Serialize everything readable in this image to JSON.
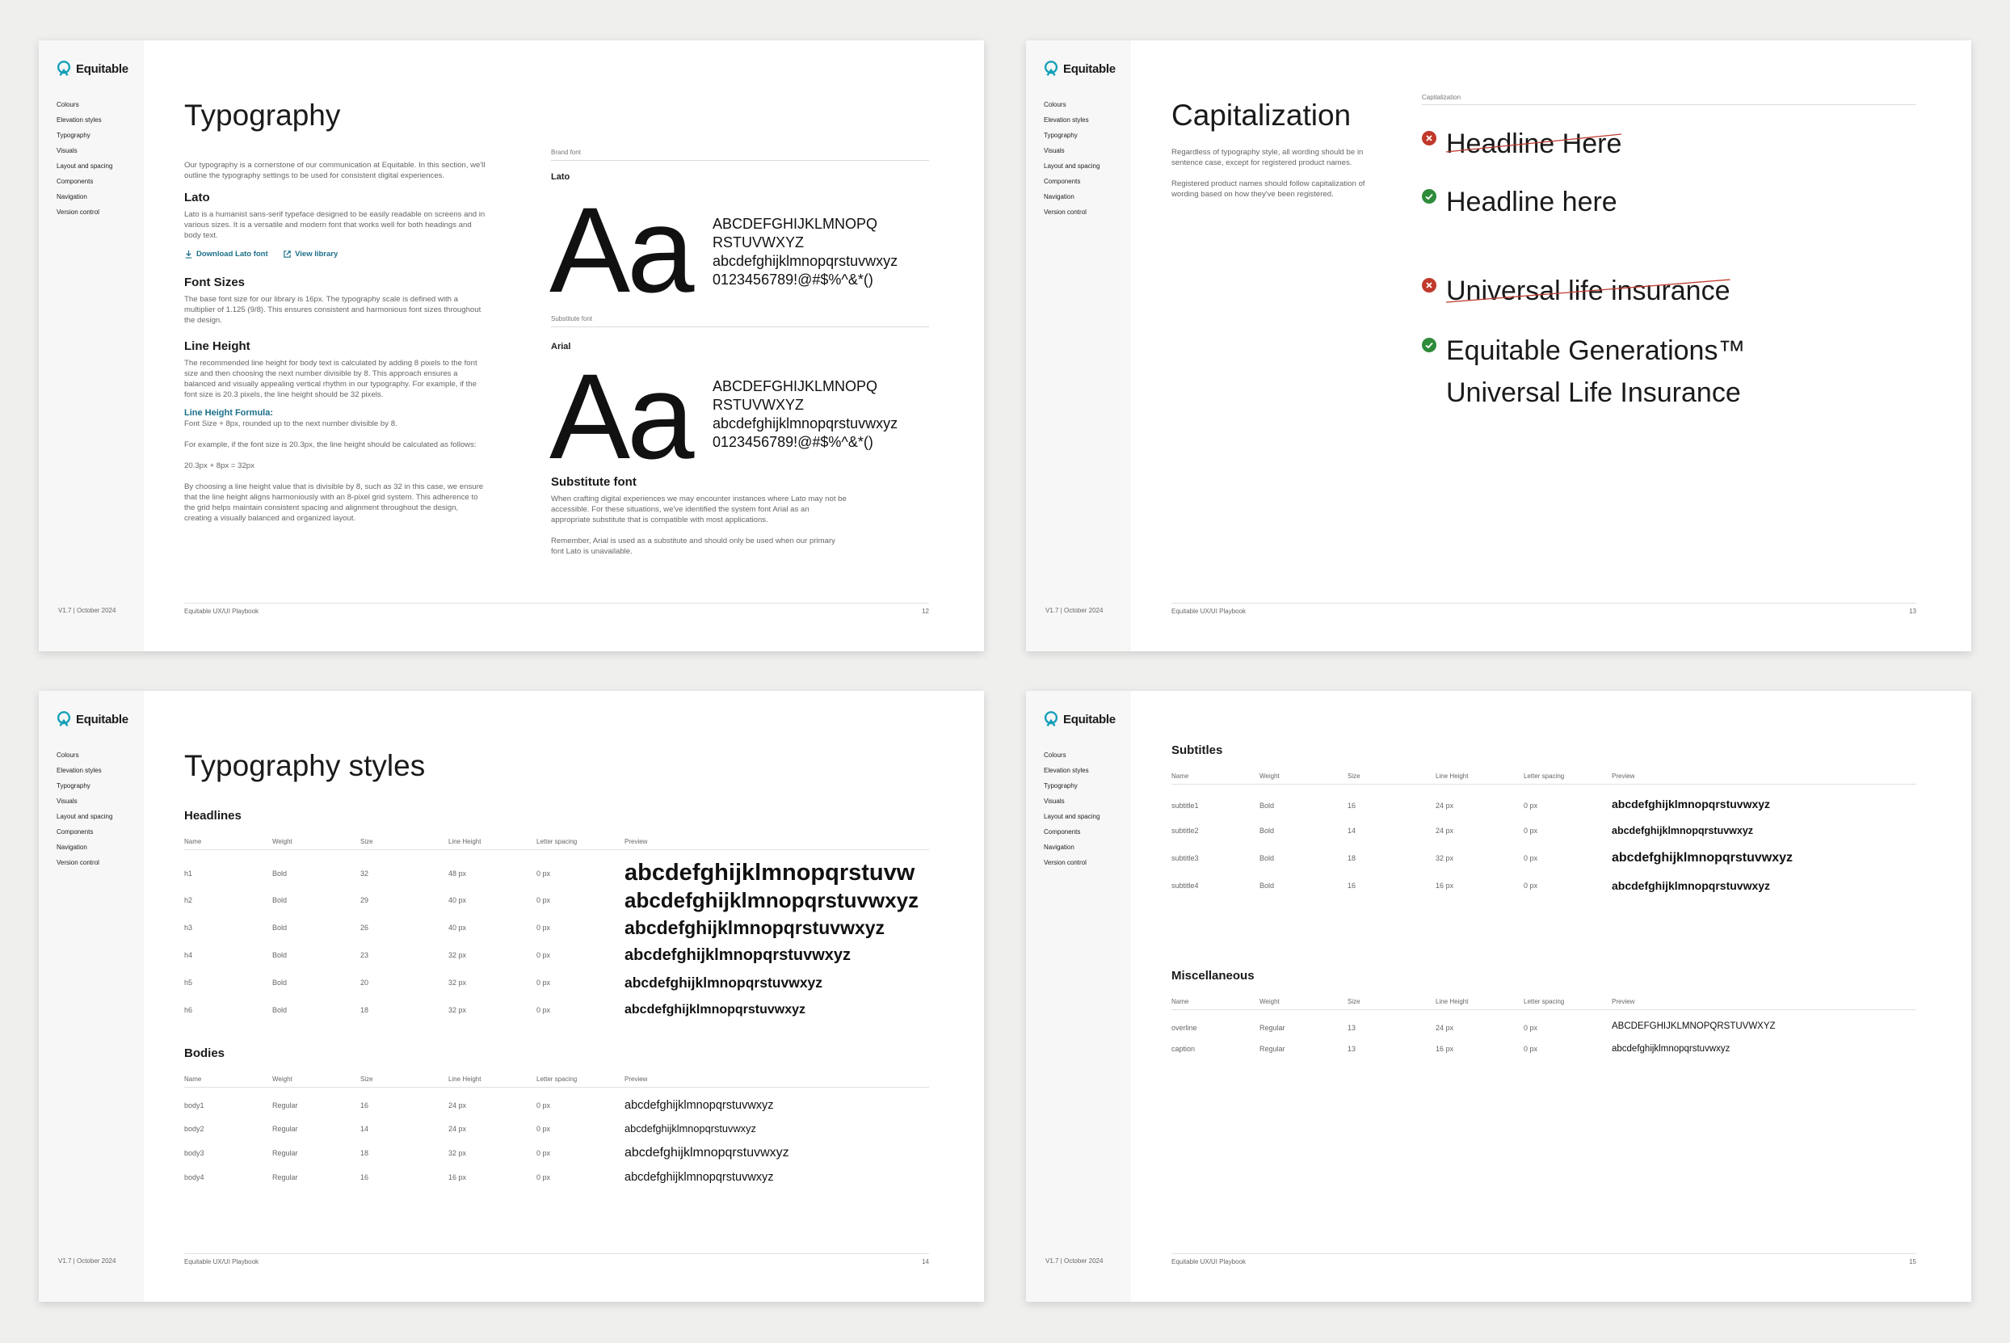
{
  "common": {
    "brand": "Equitable",
    "nav": [
      "Colours",
      "Elevation styles",
      "Typography",
      "Visuals",
      "Layout and spacing",
      "Components",
      "Navigation",
      "Version control"
    ],
    "version": "V1.7  |  October 2024",
    "footer_title": "Equitable UX/UI Playbook"
  },
  "colors": {
    "accent": "#1b6f8a",
    "error": "#c0392b",
    "success": "#2e8b3a",
    "sidebar": "#f7f7f7"
  },
  "page12": {
    "number": "12",
    "title": "Typography",
    "intro": "Our typography is a cornerstone of our communication at Equitable. In this section, we'll outline the typography settings to be used for consistent digital experiences.",
    "lato_heading": "Lato",
    "lato_text": "Lato is a humanist sans-serif typeface designed to be easily readable on screens and in various sizes. It is a versatile and modern font that works well for both headings and body text.",
    "download_link": "Download Lato font",
    "library_link": "View library",
    "font_sizes_heading": "Font Sizes",
    "font_sizes_text": "The base font size for our library is 16px. The typography scale is defined with a multiplier of 1.125 (9/8). This ensures consistent and harmonious font sizes throughout the design.",
    "line_height_heading": "Line Height",
    "line_height_text": "The recommended line height for body text is calculated by adding 8 pixels to the font size and then choosing the next number divisible by 8. This approach ensures a balanced and visually appealing vertical rhythm in our typography. For example, if the font size is 20.3 pixels, the line height should be 32 pixels.",
    "formula_heading": "Line Height Formula:",
    "formula_text": "Font Size + 8px, rounded up to the next number divisible by 8.",
    "example_text": "For example, if the font size is 20.3px, the line height should be calculated as follows:",
    "example_calc": "20.3px + 8px = 32px",
    "closing_text": "By choosing a line height value that is divisible by 8, such as 32 in this case, we ensure that the line height aligns harmoniously with an 8-pixel grid system. This adherence to the grid helps maintain consistent spacing and alignment throughout the design, creating a visually balanced and organized layout.",
    "brand_font_label": "Brand font",
    "brand_font_name": "Lato",
    "substitute_font_label": "Substitute font",
    "substitute_font_name": "Arial",
    "aa": "Aa",
    "chars_line1": "ABCDEFGHIJKLMNOPQ",
    "chars_line2": "RSTUVWXYZ",
    "chars_line3": "abcdefghijklmnopqrstuvwxyz",
    "chars_line4": "0123456789!@#$%^&*()",
    "substitute_heading": "Substitute font",
    "substitute_text": "When crafting digital experiences we may encounter instances where Lato may not be accessible. For these situations, we've identified the system font Arial as an appropriate substitute that is compatible with most applications.",
    "substitute_note": "Remember, Arial is used as a substitute and should only be used when our primary font Lato is unavailable."
  },
  "page13": {
    "number": "13",
    "title": "Capitalization",
    "text1": "Regardless of typography style, all wording should be in sentence case, except for registered product names.",
    "text2": "Registered product names should follow capitalization of wording based on how they've been registered.",
    "section_label": "Capitalization",
    "bad1": "Headline Here",
    "good1": "Headline here",
    "bad2": "Universal life insurance",
    "good2_line1": "Equitable Generations™",
    "good2_line2": "Universal Life Insurance"
  },
  "columns": [
    "Name",
    "Weight",
    "Size",
    "Line Height",
    "Letter spacing",
    "Preview"
  ],
  "page14": {
    "number": "14",
    "title": "Typography styles",
    "headlines_heading": "Headlines",
    "headlines": [
      {
        "name": "h1",
        "weight": "Bold",
        "size": "32",
        "lh": "48 px",
        "ls": "0 px",
        "preview": "abcdefghijklmnopqrstuvw"
      },
      {
        "name": "h2",
        "weight": "Bold",
        "size": "29",
        "lh": "40 px",
        "ls": "0 px",
        "preview": "abcdefghijklmnopqrstuvwxyz"
      },
      {
        "name": "h3",
        "weight": "Bold",
        "size": "26",
        "lh": "40 px",
        "ls": "0 px",
        "preview": "abcdefghijklmnopqrstuvwxyz"
      },
      {
        "name": "h4",
        "weight": "Bold",
        "size": "23",
        "lh": "32 px",
        "ls": "0 px",
        "preview": "abcdefghijklmnopqrstuvwxyz"
      },
      {
        "name": "h5",
        "weight": "Bold",
        "size": "20",
        "lh": "32 px",
        "ls": "0 px",
        "preview": "abcdefghijklmnopqrstuvwxyz"
      },
      {
        "name": "h6",
        "weight": "Bold",
        "size": "18",
        "lh": "32 px",
        "ls": "0 px",
        "preview": "abcdefghijklmnopqrstuvwxyz"
      }
    ],
    "bodies_heading": "Bodies",
    "bodies": [
      {
        "name": "body1",
        "weight": "Regular",
        "size": "16",
        "lh": "24 px",
        "ls": "0 px",
        "preview": "abcdefghijklmnopqrstuvwxyz"
      },
      {
        "name": "body2",
        "weight": "Regular",
        "size": "14",
        "lh": "24 px",
        "ls": "0 px",
        "preview": "abcdefghijklmnopqrstuvwxyz"
      },
      {
        "name": "body3",
        "weight": "Regular",
        "size": "18",
        "lh": "32 px",
        "ls": "0 px",
        "preview": "abcdefghijklmnopqrstuvwxyz"
      },
      {
        "name": "body4",
        "weight": "Regular",
        "size": "16",
        "lh": "16 px",
        "ls": "0 px",
        "preview": "abcdefghijklmnopqrstuvwxyz"
      }
    ]
  },
  "page15": {
    "number": "15",
    "subtitles_heading": "Subtitles",
    "subtitles": [
      {
        "name": "subtitle1",
        "weight": "Bold",
        "size": "16",
        "lh": "24 px",
        "ls": "0 px",
        "preview": "abcdefghijklmnopqrstuvwxyz"
      },
      {
        "name": "subtitle2",
        "weight": "Bold",
        "size": "14",
        "lh": "24 px",
        "ls": "0 px",
        "preview": "abcdefghijklmnopqrstuvwxyz"
      },
      {
        "name": "subtitle3",
        "weight": "Bold",
        "size": "18",
        "lh": "32 px",
        "ls": "0 px",
        "preview": "abcdefghijklmnopqrstuvwxyz"
      },
      {
        "name": "subtitle4",
        "weight": "Bold",
        "size": "16",
        "lh": "16 px",
        "ls": "0 px",
        "preview": "abcdefghijklmnopqrstuvwxyz"
      }
    ],
    "misc_heading": "Miscellaneous",
    "misc": [
      {
        "name": "overline",
        "weight": "Regular",
        "size": "13",
        "lh": "24 px",
        "ls": "0 px",
        "preview": "ABCDEFGHIJKLMNOPQRSTUVWXYZ"
      },
      {
        "name": "caption",
        "weight": "Regular",
        "size": "13",
        "lh": "16 px",
        "ls": "0 px",
        "preview": "abcdefghijklmnopqrstuvwxyz"
      }
    ]
  }
}
